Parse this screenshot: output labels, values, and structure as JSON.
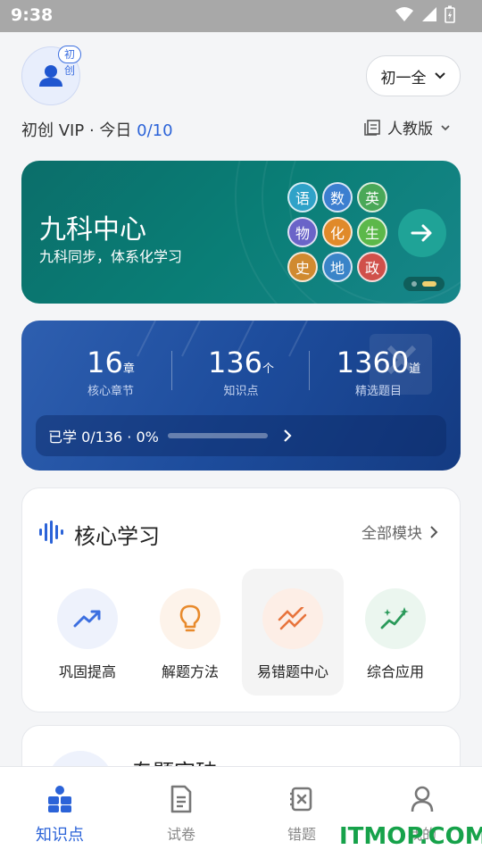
{
  "status": {
    "time": "9:38"
  },
  "header": {
    "avatar_tag": "初创",
    "grade": "初一全",
    "vip_text": "初创 VIP",
    "today_label": "今日",
    "today_count": "0/10",
    "edition": "人教版"
  },
  "banner": {
    "title": "九科中心",
    "subtitle": "九科同步，体系化学习",
    "subjects": [
      {
        "name": "语",
        "color": "#2fa2c8"
      },
      {
        "name": "数",
        "color": "#3c7fd0"
      },
      {
        "name": "英",
        "color": "#4aa858"
      },
      {
        "name": "物",
        "color": "#6a64c8"
      },
      {
        "name": "化",
        "color": "#e08a2a"
      },
      {
        "name": "生",
        "color": "#5cb84a"
      },
      {
        "name": "史",
        "color": "#d08a30"
      },
      {
        "name": "地",
        "color": "#3a84c8"
      },
      {
        "name": "政",
        "color": "#d0504a"
      }
    ]
  },
  "stats": {
    "chapters": {
      "num": "16",
      "unit": "章",
      "label": "核心章节"
    },
    "points": {
      "num": "136",
      "unit": "个",
      "label": "知识点"
    },
    "questions": {
      "num": "1360",
      "unit": "道",
      "label": "精选题目"
    },
    "progress_text": "已学 0/136 · 0%",
    "progress_fraction": 0
  },
  "core": {
    "title": "核心学习",
    "more": "全部模块",
    "modules": [
      {
        "label": "巩固提高",
        "icon": "trend-up-icon",
        "bg": "#eef2fc",
        "color": "#3c6fe0"
      },
      {
        "label": "解题方法",
        "icon": "lightbulb-icon",
        "bg": "#fdf3ea",
        "color": "#e88a2c"
      },
      {
        "label": "易错题中心",
        "icon": "zigzag-icon",
        "bg": "#fdeee6",
        "color": "#e8743c"
      },
      {
        "label": "综合应用",
        "icon": "sparkle-chart-icon",
        "bg": "#ebf6ef",
        "color": "#2a9a5a"
      }
    ]
  },
  "section2": {
    "title": "专题突破"
  },
  "tabs": [
    {
      "label": "知识点",
      "icon": "knowledge-icon"
    },
    {
      "label": "试卷",
      "icon": "paper-icon"
    },
    {
      "label": "错题",
      "icon": "wrong-question-icon"
    },
    {
      "label": "我的",
      "icon": "profile-icon"
    }
  ],
  "watermark": "ITMOP.COM"
}
